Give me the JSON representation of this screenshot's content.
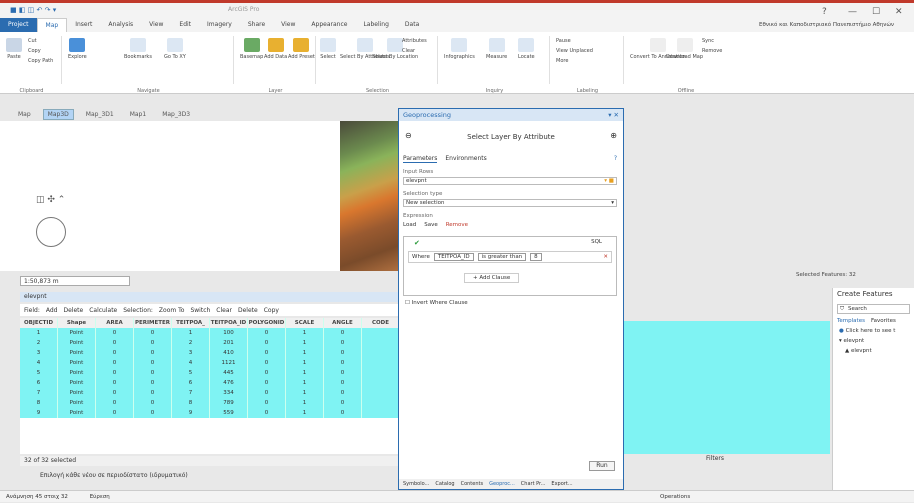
{
  "app": {
    "title": "ArcGIS Pro",
    "signin": "Εθνικό και Καποδιστριακό Πανεπιστήμιο Αθηνών"
  },
  "ribbon_tabs": [
    "Project",
    "Map",
    "Insert",
    "Analysis",
    "View",
    "Edit",
    "Imagery",
    "Share",
    "View",
    "Appearance",
    "Labeling",
    "Data"
  ],
  "ribbon": {
    "clipboard": {
      "label": "Clipboard",
      "paste": "Paste",
      "cut": "Cut",
      "copy": "Copy",
      "copy_path": "Copy Path"
    },
    "navigate": {
      "label": "Navigate",
      "explore": "Explore",
      "bookmarks": "Bookmarks",
      "goto": "Go To XY"
    },
    "layer": {
      "label": "Layer",
      "basemap": "Basemap",
      "add_data": "Add Data",
      "add_preset": "Add Preset"
    },
    "selection": {
      "label": "Selection",
      "select": "Select",
      "by_attributes": "Select By Attributes",
      "by_location": "Select By Location",
      "attributes": "Attributes",
      "clear": "Clear"
    },
    "inquiry": {
      "label": "Inquiry",
      "infographics": "Infographics",
      "measure": "Measure",
      "locate": "Locate"
    },
    "labeling": {
      "label": "Labeling",
      "pause": "Pause",
      "view_unplaced": "View Unplaced",
      "more": "More"
    },
    "offline": {
      "label": "Offline",
      "convert": "Convert To Annotation",
      "download": "Download Map",
      "sync": "Sync",
      "remove": "Remove"
    }
  },
  "view_tabs": [
    "Map",
    "Map3D",
    "Map_3D1",
    "Map1",
    "Map_3D3"
  ],
  "scale": "1:50,873 m",
  "attribute_table": {
    "title": "elevpnt",
    "toolbar": [
      "Field:",
      "Add",
      "Delete",
      "Calculate",
      "Selection:",
      "Zoom To",
      "Switch",
      "Clear",
      "Delete",
      "Copy"
    ],
    "columns": [
      "OBJECTID",
      "Shape",
      "AREA",
      "PERIMETER",
      "TEITPOA_",
      "TEITPOA_ID",
      "POLYGONID",
      "SCALE",
      "ANGLE",
      "CODE"
    ],
    "rows": [
      [
        "1",
        "Point",
        "0",
        "0",
        "1",
        "100",
        "0",
        "1",
        "0",
        ""
      ],
      [
        "2",
        "Point",
        "0",
        "0",
        "2",
        "201",
        "0",
        "1",
        "0",
        ""
      ],
      [
        "3",
        "Point",
        "0",
        "0",
        "3",
        "410",
        "0",
        "1",
        "0",
        ""
      ],
      [
        "4",
        "Point",
        "0",
        "0",
        "4",
        "1121",
        "0",
        "1",
        "0",
        ""
      ],
      [
        "5",
        "Point",
        "0",
        "0",
        "5",
        "445",
        "0",
        "1",
        "0",
        ""
      ],
      [
        "6",
        "Point",
        "0",
        "0",
        "6",
        "476",
        "0",
        "1",
        "0",
        ""
      ],
      [
        "7",
        "Point",
        "0",
        "0",
        "7",
        "334",
        "0",
        "1",
        "0",
        ""
      ],
      [
        "8",
        "Point",
        "0",
        "0",
        "8",
        "789",
        "0",
        "1",
        "0",
        ""
      ],
      [
        "9",
        "Point",
        "0",
        "0",
        "9",
        "559",
        "0",
        "1",
        "0",
        ""
      ]
    ],
    "status": "32 of 32 selected"
  },
  "instruction": "Επιλογή κάθε νέου σε περιοδίστατο (ιδρυματικό)",
  "filters_label": "Filters",
  "selected_features": "Selected Features: 32",
  "geoprocessing": {
    "pane_title": "Geoprocessing",
    "tool_title": "Select Layer By Attribute",
    "tabs": [
      "Parameters",
      "Environments"
    ],
    "input_rows_label": "Input Rows",
    "input_rows_value": "elevpnt",
    "selection_type_label": "Selection type",
    "selection_type_value": "New selection",
    "expression_label": "Expression",
    "expr_buttons": [
      "Load",
      "Save",
      "Remove"
    ],
    "sql_toggle": "SQL",
    "where": "Where",
    "field": "TEITPOA_ID",
    "operator": "is greater than",
    "value": "8",
    "add_clause": "+ Add Clause",
    "invert": "Invert Where Clause",
    "run": "Run",
    "bottom_tabs": [
      "Symbolo...",
      "Catalog",
      "Contents",
      "Geoproc...",
      "Chart Pr...",
      "Export..."
    ]
  },
  "create_features": {
    "title": "Create Features",
    "search": "Search",
    "tabs": [
      "Templates",
      "Favorites"
    ],
    "hint": "Click here to see t",
    "group": "▾ elevpnt",
    "item": "elevpnt"
  },
  "bottombar": {
    "coords": "Ανάμνηση 45 στοιχ 32",
    "mode": "Εύρεση",
    "right": "Operations"
  }
}
